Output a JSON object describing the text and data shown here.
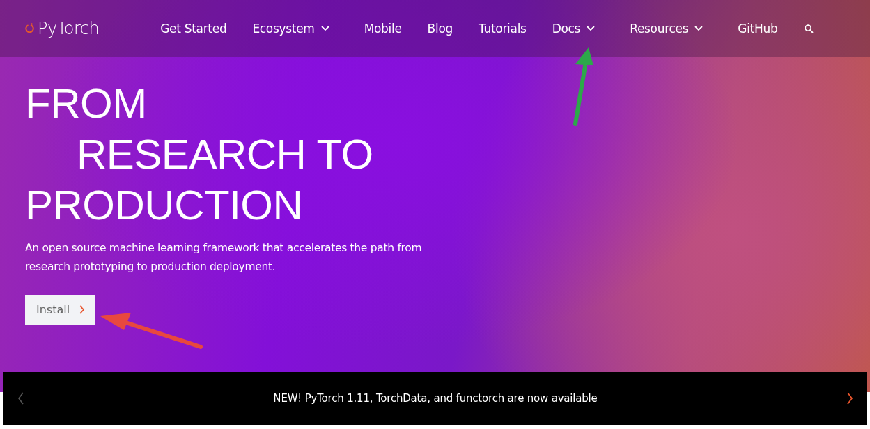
{
  "header": {
    "logo": "PyTorch",
    "nav": [
      {
        "label": "Get Started",
        "has_dropdown": false
      },
      {
        "label": "Ecosystem",
        "has_dropdown": true
      },
      {
        "label": "Mobile",
        "has_dropdown": false
      },
      {
        "label": "Blog",
        "has_dropdown": false
      },
      {
        "label": "Tutorials",
        "has_dropdown": false
      },
      {
        "label": "Docs",
        "has_dropdown": true
      },
      {
        "label": "Resources",
        "has_dropdown": true
      },
      {
        "label": "GitHub",
        "has_dropdown": false
      }
    ]
  },
  "hero": {
    "headline": [
      {
        "text": "FROM",
        "indented": false
      },
      {
        "text": "RESEARCH TO",
        "indented": true
      },
      {
        "text": "PRODUCTION",
        "indented": false
      }
    ],
    "description": "An open source machine learning framework that accelerates the path from research prototyping to production deployment.",
    "button": "Install"
  },
  "banner": {
    "text": "NEW! PyTorch 1.11, TorchData, and functorch are now available",
    "prev_disabled": true,
    "next_disabled": false
  },
  "annotations": [
    {
      "color": "#e8483f"
    },
    {
      "color": "#2da84a"
    }
  ]
}
